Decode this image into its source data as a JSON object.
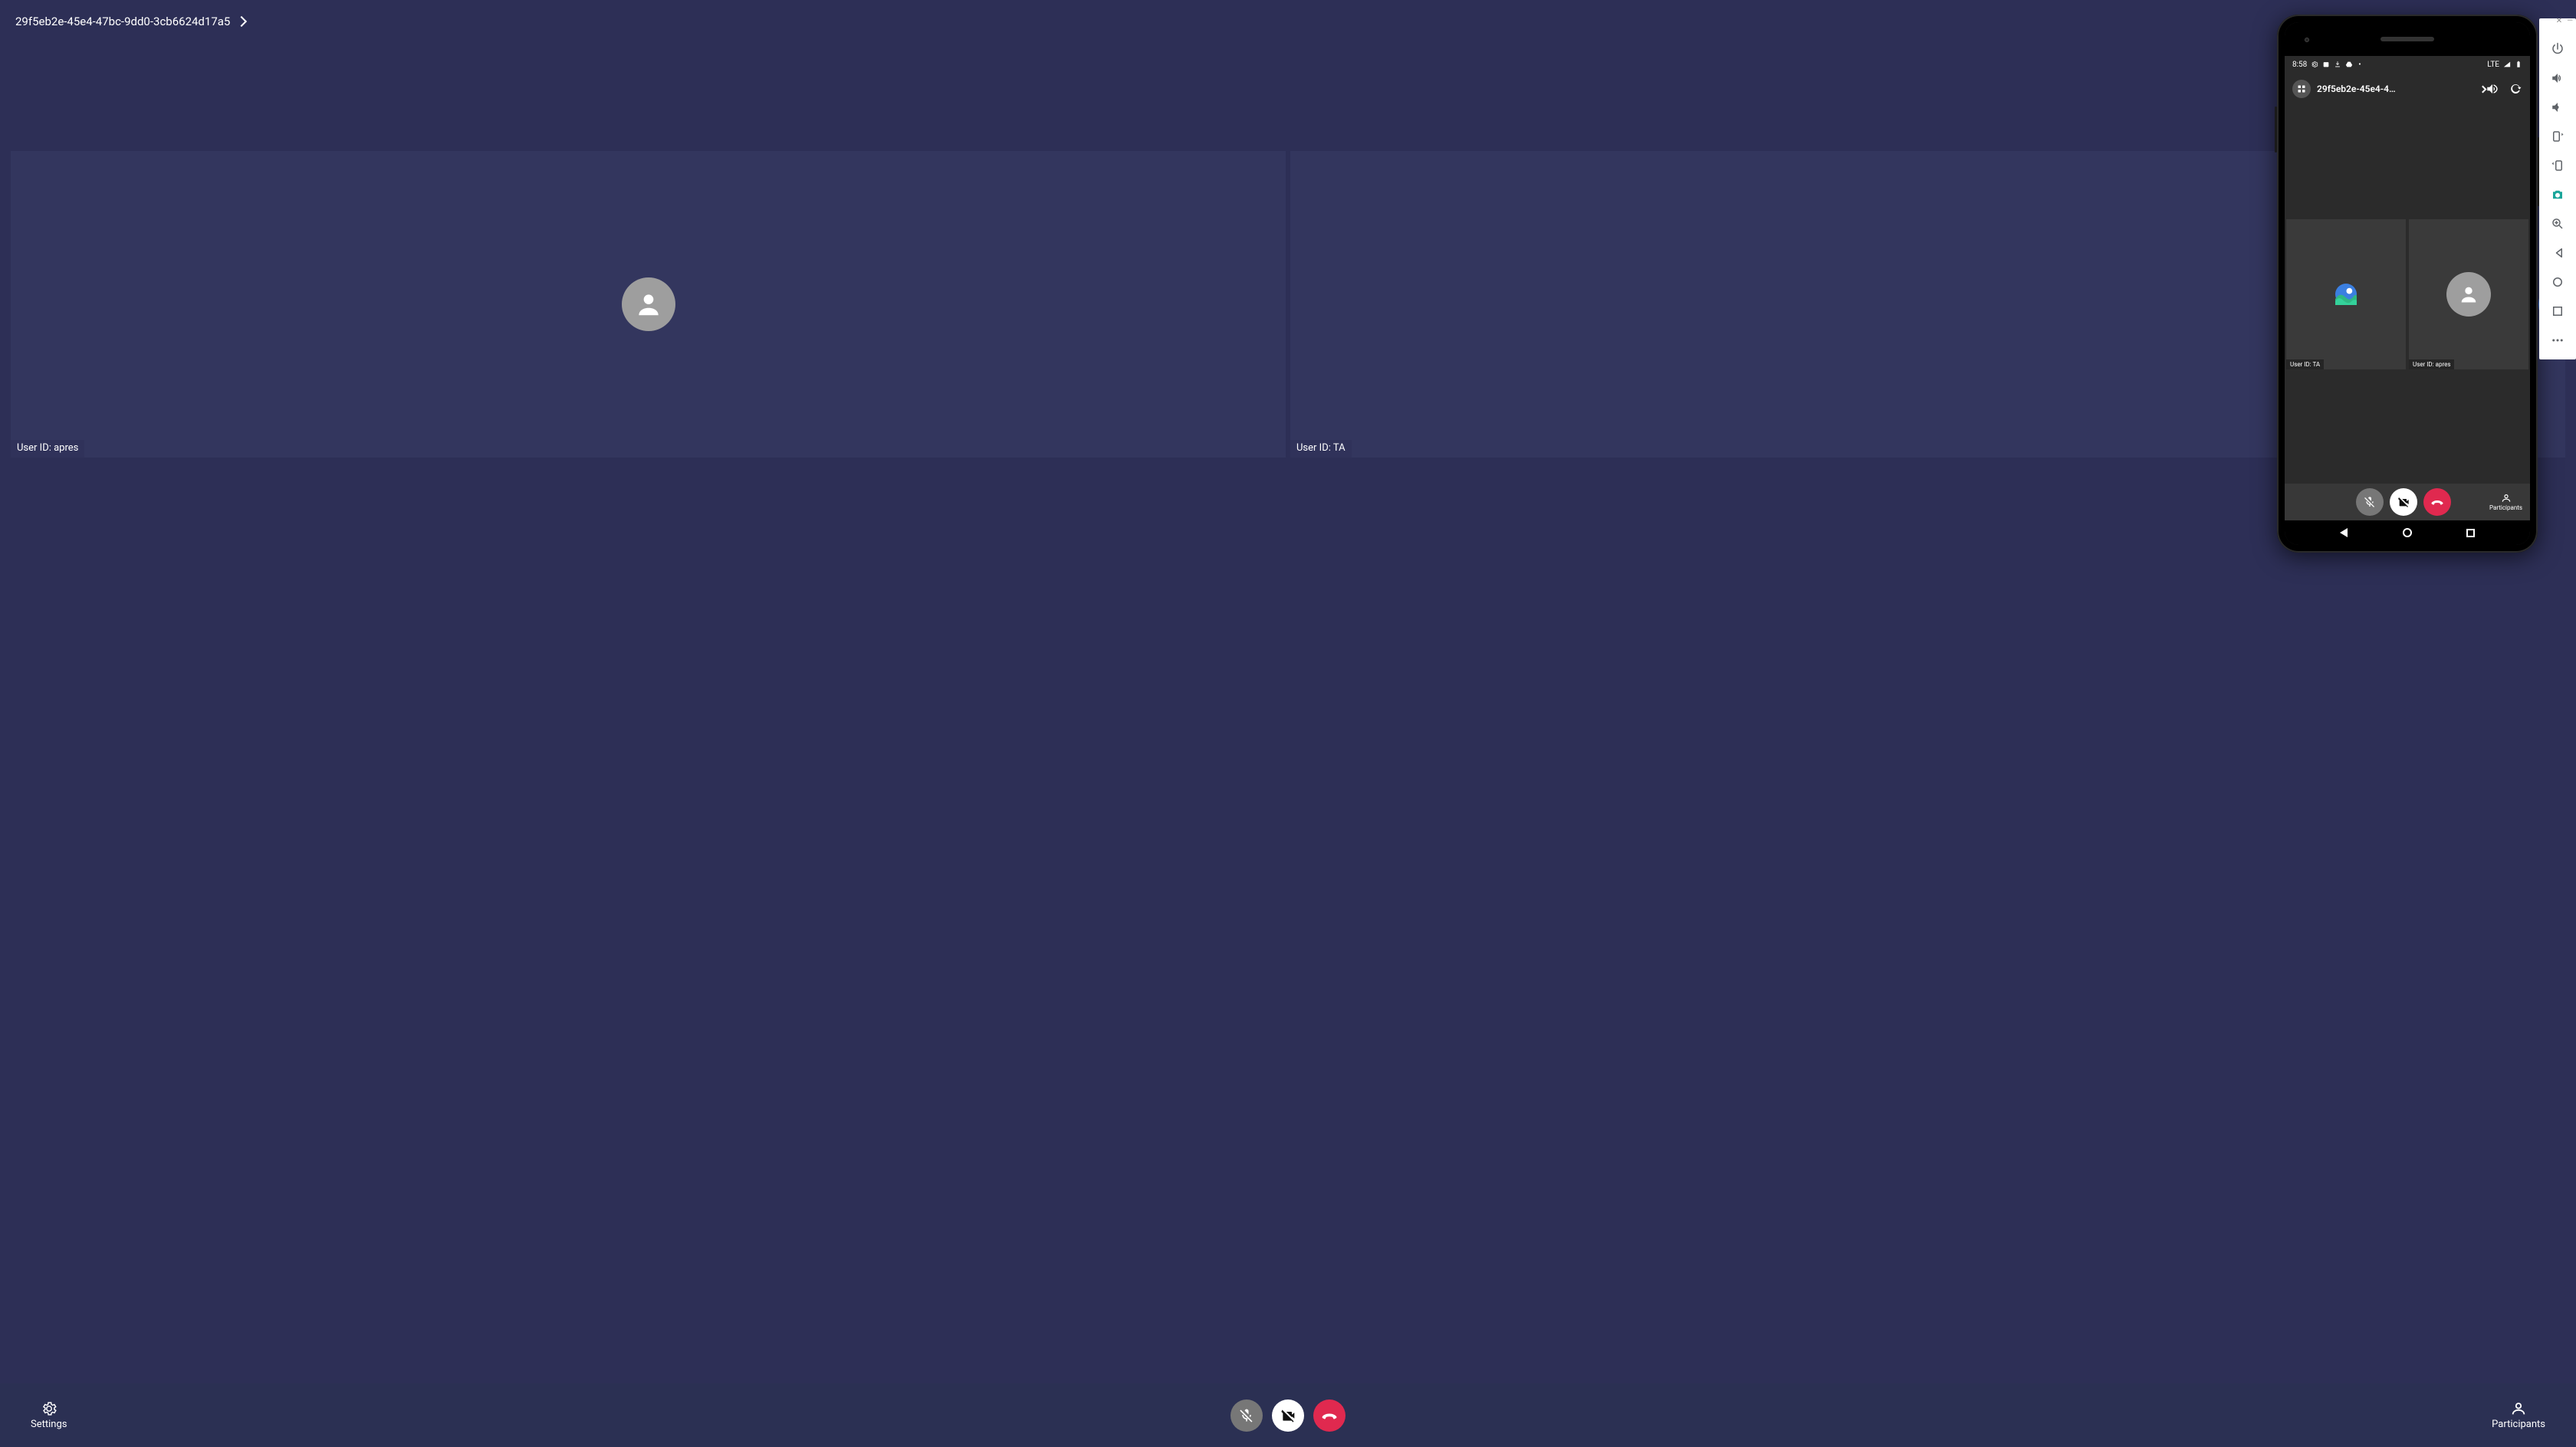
{
  "header": {
    "call_id": "29f5eb2e-45e4-47bc-9dd0-3cb6624d17a5"
  },
  "tiles": [
    {
      "label": "User ID: apres"
    },
    {
      "label": "User ID: TA"
    }
  ],
  "bottombar": {
    "settings_label": "Settings",
    "participants_label": "Participants"
  },
  "phone": {
    "status": {
      "time": "8:58",
      "network": "LTE"
    },
    "header": {
      "title": "29f5eb2e-45e4-4…"
    },
    "tiles": [
      {
        "label": "User ID: TA"
      },
      {
        "label": "User ID: apres"
      }
    ],
    "bottombar": {
      "participants_label": "Participants"
    }
  }
}
